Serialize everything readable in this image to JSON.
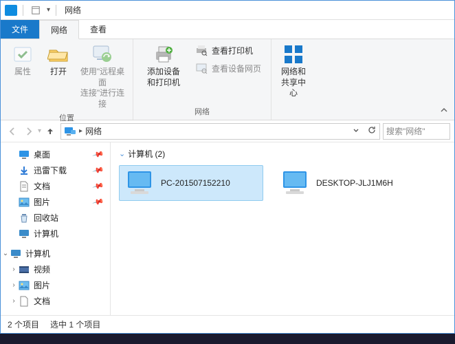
{
  "titlebar": {
    "title": "网络"
  },
  "tabs": {
    "file": "文件",
    "network": "网络",
    "view": "查看"
  },
  "ribbon": {
    "group1": {
      "properties": "属性",
      "open": "打开",
      "rdp": "使用\"远程桌面\n连接\"进行连接",
      "label": "位置"
    },
    "group2": {
      "add_device": "添加设备\n和打印机",
      "view_printers": "查看打印机",
      "view_device_page": "查看设备网页",
      "label": "网络"
    },
    "group3": {
      "network_center": "网络和\n共享中心"
    }
  },
  "address": {
    "segment": "网络"
  },
  "search": {
    "placeholder": "搜索\"网络\""
  },
  "sidebar": {
    "desktop": "桌面",
    "thunder": "迅雷下载",
    "docs": "文档",
    "pics": "图片",
    "recycle": "回收站",
    "computer_sub": "计算机",
    "computer": "计算机",
    "videos": "视频",
    "pics2": "图片",
    "docs2": "文档"
  },
  "content": {
    "section": "计算机 (2)",
    "items": [
      {
        "name": "PC-201507152210"
      },
      {
        "name": "DESKTOP-JLJ1M6H"
      }
    ]
  },
  "status": {
    "count": "2 个项目",
    "selected": "选中 1 个项目"
  }
}
